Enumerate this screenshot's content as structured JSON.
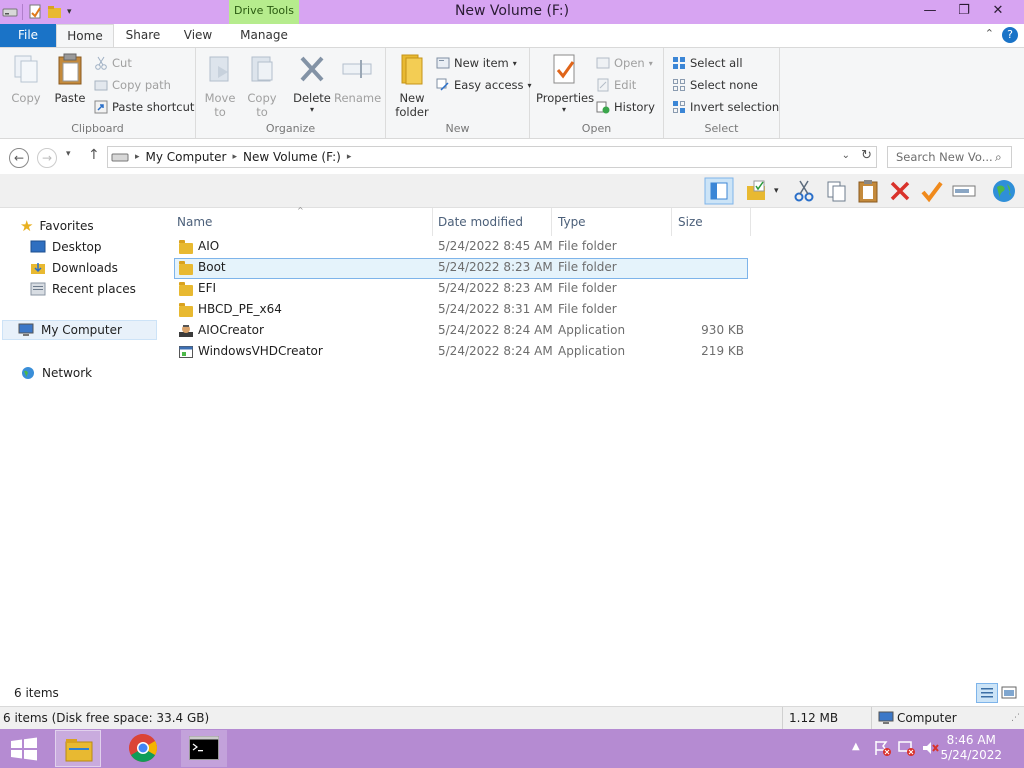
{
  "window": {
    "title": "New Volume (F:)",
    "contextual_tab": "Drive Tools",
    "minimize": "—",
    "maximize": "❐",
    "close": "✕"
  },
  "tabs": {
    "file": "File",
    "home": "Home",
    "share": "Share",
    "view": "View",
    "manage": "Manage",
    "help": "?"
  },
  "ribbon": {
    "clipboard": {
      "label": "Clipboard",
      "copy": "Copy",
      "paste": "Paste",
      "cut": "Cut",
      "copy_path": "Copy path",
      "paste_shortcut": "Paste shortcut"
    },
    "organize": {
      "label": "Organize",
      "move_to_1": "Move",
      "move_to_2": "to",
      "copy_to_1": "Copy",
      "copy_to_2": "to",
      "delete": "Delete",
      "rename": "Rename"
    },
    "new": {
      "label": "New",
      "new_folder_1": "New",
      "new_folder_2": "folder",
      "new_item": "New item",
      "easy_access": "Easy access"
    },
    "open": {
      "label": "Open",
      "properties": "Properties",
      "open": "Open",
      "edit": "Edit",
      "history": "History"
    },
    "select": {
      "label": "Select",
      "select_all": "Select all",
      "select_none": "Select none",
      "invert_selection": "Invert selection"
    }
  },
  "address": {
    "crumbs": [
      "My Computer",
      "New Volume (F:)"
    ],
    "search_placeholder": "Search New Vo..."
  },
  "nav": {
    "favorites": "Favorites",
    "desktop": "Desktop",
    "downloads": "Downloads",
    "recent_places": "Recent places",
    "my_computer": "My Computer",
    "network": "Network"
  },
  "columns": {
    "name": "Name",
    "date": "Date modified",
    "type": "Type",
    "size": "Size"
  },
  "files": [
    {
      "name": "AIO",
      "date": "5/24/2022 8:45 AM",
      "type": "File folder",
      "size": "",
      "icon": "folder-icon"
    },
    {
      "name": "Boot",
      "date": "5/24/2022 8:23 AM",
      "type": "File folder",
      "size": "",
      "icon": "folder-icon",
      "selected": true
    },
    {
      "name": "EFI",
      "date": "5/24/2022 8:23 AM",
      "type": "File folder",
      "size": "",
      "icon": "folder-icon"
    },
    {
      "name": "HBCD_PE_x64",
      "date": "5/24/2022 8:31 AM",
      "type": "File folder",
      "size": "",
      "icon": "folder-icon"
    },
    {
      "name": "AIOCreator",
      "date": "5/24/2022 8:24 AM",
      "type": "Application",
      "size": "930 KB",
      "icon": "app-icon"
    },
    {
      "name": "WindowsVHDCreator",
      "date": "5/24/2022 8:24 AM",
      "type": "Application",
      "size": "219 KB",
      "icon": "app-window-icon"
    }
  ],
  "status": {
    "item_count": "6 items",
    "details": "6 items (Disk free space: 33.4 GB)",
    "size": "1.12 MB",
    "location": "Computer"
  },
  "taskbar": {
    "time": "8:46 AM",
    "date": "5/24/2022"
  },
  "colors": {
    "titlebar": "#d7a4f2",
    "file_tab": "#1a73c7",
    "drive_tools": "#b6ec8d",
    "taskbar": "#b58bd2",
    "selection": "#e5f3fb"
  }
}
